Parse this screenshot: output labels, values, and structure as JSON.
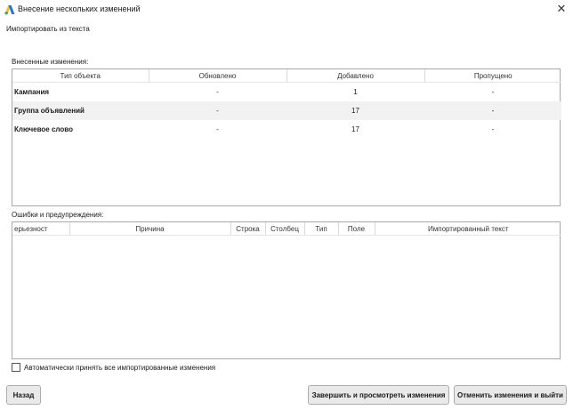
{
  "window": {
    "title": "Внесение нескольких изменений",
    "close_glyph": "✕",
    "logo_icon": "google-ads-logo",
    "logo_colors": [
      "#1a73e8",
      "#fbbc04",
      "#34a853"
    ]
  },
  "subtitle": "Импортировать из текста",
  "changes": {
    "label": "Внесенные изменения:",
    "columns": [
      "Тип объекта",
      "Обновлено",
      "Добавлено",
      "Пропущено"
    ],
    "rows": [
      {
        "type": "Кампания",
        "updated": "-",
        "added": "1",
        "skipped": "-"
      },
      {
        "type": "Группа объявлений",
        "updated": "-",
        "added": "17",
        "skipped": "-"
      },
      {
        "type": "Ключевое слово",
        "updated": "-",
        "added": "17",
        "skipped": "-"
      }
    ]
  },
  "errors": {
    "label": "Ошибки и предупреждения:",
    "columns": [
      "ерьезност",
      "Причина",
      "Строка",
      "Столбец",
      "Тип",
      "Поле",
      "Импортированный текст"
    ]
  },
  "auto_accept": {
    "label": "Автоматически принять все импортированные изменения",
    "checked": false
  },
  "buttons": {
    "back": "Назад",
    "finish": "Завершить и просмотреть изменения",
    "cancel": "Отменить изменения и выйти"
  }
}
